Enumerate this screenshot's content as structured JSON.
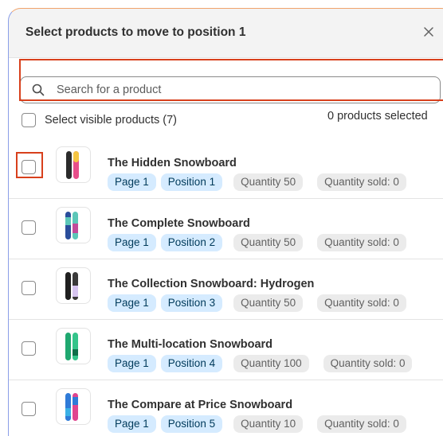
{
  "modal": {
    "title": "Select products to move to position 1",
    "close_label": "×"
  },
  "search": {
    "placeholder": "Search for a product",
    "value": ""
  },
  "select_visible": {
    "label": "Select visible products (7)"
  },
  "selection_count": "0 products selected",
  "products": [
    {
      "name": "The Hidden Snowboard",
      "page": "Page 1",
      "position": "Position 1",
      "quantity": "Quantity 50",
      "sold": "Quantity sold: 0",
      "colors": [
        "#2b2b2b",
        "#e84e8a",
        "#f5c542"
      ]
    },
    {
      "name": "The Complete Snowboard",
      "page": "Page 1",
      "position": "Position 2",
      "quantity": "Quantity 50",
      "sold": "Quantity sold: 0",
      "colors": [
        "#2a4d9b",
        "#5cc7b8",
        "#c24a9a"
      ]
    },
    {
      "name": "The Collection Snowboard: Hydrogen",
      "page": "Page 1",
      "position": "Position 3",
      "quantity": "Quantity 50",
      "sold": "Quantity sold: 0",
      "colors": [
        "#1f1f1f",
        "#3a3a3a",
        "#d6c4f0"
      ]
    },
    {
      "name": "The Multi-location Snowboard",
      "page": "Page 1",
      "position": "Position 4",
      "quantity": "Quantity 100",
      "sold": "Quantity sold: 0",
      "colors": [
        "#1fa870",
        "#34c48a",
        "#0e6e48"
      ]
    },
    {
      "name": "The Compare at Price Snowboard",
      "page": "Page 1",
      "position": "Position 5",
      "quantity": "Quantity 10",
      "sold": "Quantity sold: 0",
      "colors": [
        "#2f7bd8",
        "#e0458f",
        "#3ab0e6"
      ]
    }
  ],
  "colors": {
    "accent_highlight": "#d8401c",
    "badge_blue_bg": "#d5ebff",
    "badge_gray_bg": "#ebebeb",
    "header_bg": "#f3f3f3"
  }
}
